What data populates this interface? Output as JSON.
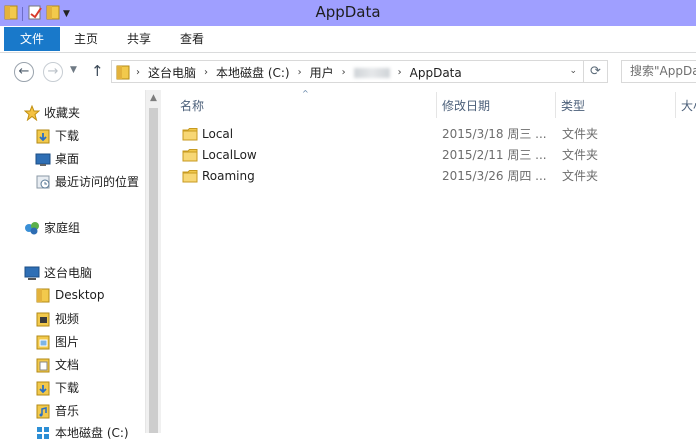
{
  "window": {
    "title": "AppData"
  },
  "ribbon": {
    "file_tab": "文件",
    "tabs": [
      "主页",
      "共享",
      "查看"
    ]
  },
  "address": {
    "crumbs": [
      "这台电脑",
      "本地磁盘 (C:)",
      "用户"
    ],
    "current": "AppData"
  },
  "search": {
    "placeholder": "搜索\"AppData\""
  },
  "nav": {
    "favorites": {
      "label": "收藏夹",
      "items": [
        "下载",
        "桌面",
        "最近访问的位置"
      ]
    },
    "homegroup": {
      "label": "家庭组"
    },
    "computer": {
      "label": "这台电脑",
      "items": [
        "Desktop",
        "视频",
        "图片",
        "文档",
        "下载",
        "音乐",
        "本地磁盘 (C:)"
      ]
    }
  },
  "columns": {
    "name": "名称",
    "date": "修改日期",
    "type": "类型",
    "size": "大小"
  },
  "files": [
    {
      "name": "Local",
      "date": "2015/3/18 周三 ...",
      "type": "文件夹"
    },
    {
      "name": "LocalLow",
      "date": "2015/2/11 周三 ...",
      "type": "文件夹"
    },
    {
      "name": "Roaming",
      "date": "2015/3/26 周四 ...",
      "type": "文件夹"
    }
  ],
  "colors": {
    "titlebar": "#9f9fff",
    "file_tab": "#1979ca",
    "folder": "#f2c94c"
  }
}
